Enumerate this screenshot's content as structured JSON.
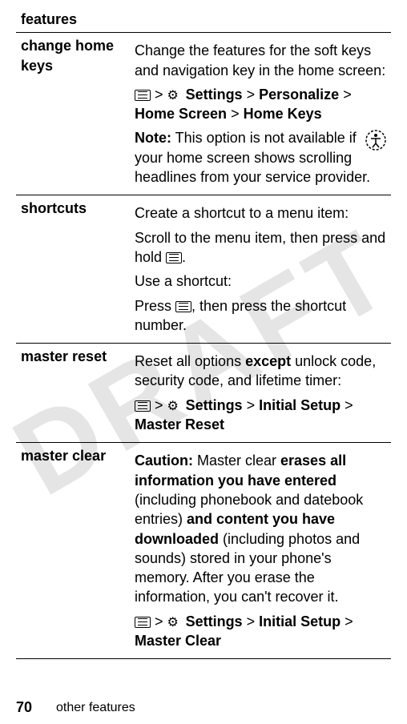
{
  "watermark": "DRAFT",
  "header": "features",
  "rows": [
    {
      "label": "change home keys",
      "intro": "Change the features for the soft keys and navigation key in the home screen:",
      "path_settings": "Settings",
      "path_personalize": "Personalize",
      "path_homescreen": "Home Screen",
      "path_homekeys": "Home Keys",
      "note_label": "Note:",
      "note_text": " This option is not available if your home screen shows scrolling headlines from your service provider."
    },
    {
      "label": "shortcuts",
      "line1": "Create a shortcut to a menu item:",
      "line2a": "Scroll to the menu item, then press and hold ",
      "line2b": ".",
      "line3": "Use a shortcut:",
      "line4a": "Press ",
      "line4b": ", then press the shortcut number."
    },
    {
      "label": "master reset",
      "text1a": "Reset all options ",
      "text1b": "except",
      "text1c": " unlock code, security code, and lifetime timer:",
      "path_settings": "Settings",
      "path_initial": "Initial Setup",
      "path_master": "Master Reset"
    },
    {
      "label": "master clear",
      "caution_label": "Caution:",
      "text_a": " Master clear ",
      "text_b": "erases all information you have entered",
      "text_c": " (including phonebook and datebook entries) ",
      "text_d": "and content you have downloaded",
      "text_e": " (including photos and sounds) stored in your phone's memory. After you erase the information, you can't recover it.",
      "path_settings": "Settings",
      "path_initial": "Initial Setup",
      "path_master": "Master Clear"
    }
  ],
  "footer": {
    "page": "70",
    "text": "other features"
  },
  "gt": ">"
}
